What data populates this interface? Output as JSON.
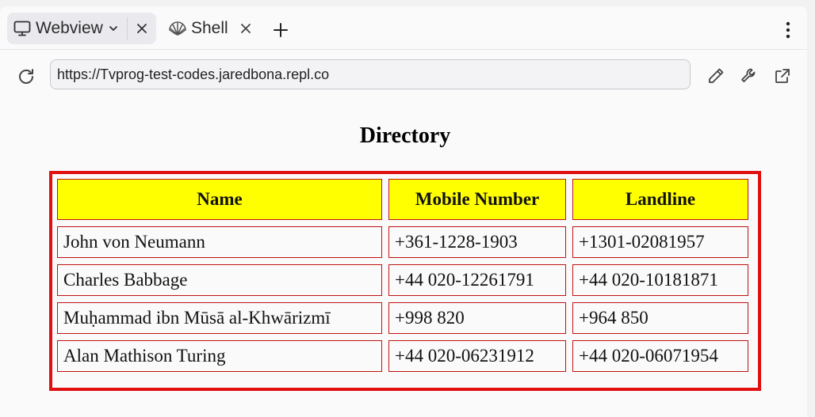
{
  "tabs": [
    {
      "label": "Webview",
      "icon": "monitor-icon",
      "active": true
    },
    {
      "label": "Shell",
      "icon": "shell-icon",
      "active": false
    }
  ],
  "address_bar": {
    "url": "https://Tvprog-test-codes.jaredbona.repl.co"
  },
  "page": {
    "heading": "Directory",
    "table": {
      "headers": [
        "Name",
        "Mobile Number",
        "Landline"
      ],
      "rows": [
        [
          "John von Neumann",
          "+361-1228-1903",
          "+1301-02081957"
        ],
        [
          "Charles Babbage",
          "+44 020-12261791",
          "+44 020-10181871"
        ],
        [
          "Muḥammad ibn Mūsā al-Khwārizmī",
          "+998 820",
          "+964 850"
        ],
        [
          "Alan Mathison Turing",
          "+44 020-06231912",
          "+44 020-06071954"
        ]
      ]
    }
  },
  "colors": {
    "header_bg": "#ffff00",
    "table_outer_border": "#e01010",
    "cell_border": "#c21212"
  }
}
